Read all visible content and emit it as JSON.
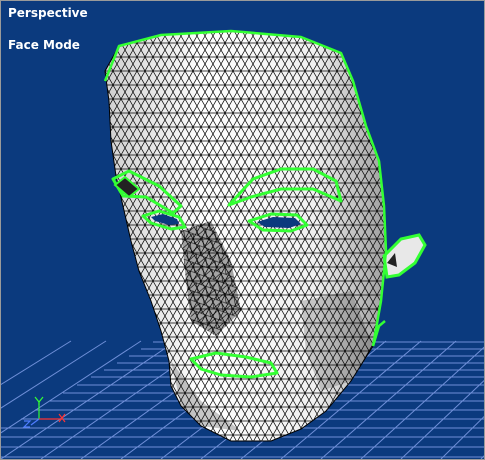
{
  "viewport": {
    "view_label": "Perspective",
    "mode_label": "Face Mode"
  },
  "colors": {
    "background": "#0b3a7e",
    "grid": "#6f8fd8",
    "selection": "#33ff33",
    "mesh_fill": "#f2f2f2",
    "wire": "#000000"
  },
  "icons": {
    "axis_gizmo": "xyz-axis-icon"
  }
}
